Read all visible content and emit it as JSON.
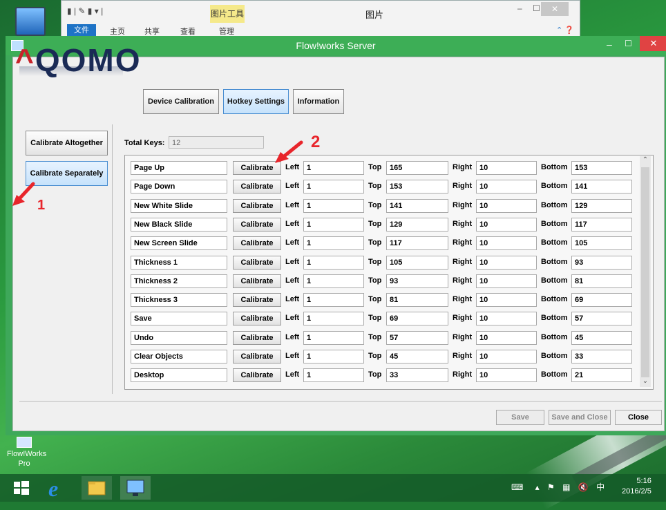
{
  "explorer": {
    "title": "图片",
    "context_tab": "图片工具",
    "tabs": [
      "文件",
      "主页",
      "共享",
      "查看",
      "管理"
    ],
    "min": "–",
    "max": "☐",
    "close": "✕"
  },
  "window": {
    "title": "Flow!works Server",
    "min": "–",
    "max": "☐",
    "close": "✕"
  },
  "logo": {
    "text": "QOMO"
  },
  "tabs": {
    "device": "Device Calibration",
    "hotkey": "Hotkey Settings",
    "info": "Information"
  },
  "side": {
    "altogether": "Calibrate Altogether",
    "separately": "Calibrate Separately"
  },
  "total_keys": {
    "label": "Total Keys:",
    "value": "12"
  },
  "field_labels": {
    "left": "Left",
    "top": "Top",
    "right": "Right",
    "bottom": "Bottom"
  },
  "calibrate_label": "Calibrate",
  "hotkeys": [
    {
      "name": "Page Up",
      "left": "1",
      "top": "165",
      "right": "10",
      "bottom": "153"
    },
    {
      "name": "Page Down",
      "left": "1",
      "top": "153",
      "right": "10",
      "bottom": "141"
    },
    {
      "name": "New White Slide",
      "left": "1",
      "top": "141",
      "right": "10",
      "bottom": "129"
    },
    {
      "name": "New Black Slide",
      "left": "1",
      "top": "129",
      "right": "10",
      "bottom": "117"
    },
    {
      "name": "New Screen Slide",
      "left": "1",
      "top": "117",
      "right": "10",
      "bottom": "105"
    },
    {
      "name": "Thickness 1",
      "left": "1",
      "top": "105",
      "right": "10",
      "bottom": "93"
    },
    {
      "name": "Thickness 2",
      "left": "1",
      "top": "93",
      "right": "10",
      "bottom": "81"
    },
    {
      "name": "Thickness 3",
      "left": "1",
      "top": "81",
      "right": "10",
      "bottom": "69"
    },
    {
      "name": "Save",
      "left": "1",
      "top": "69",
      "right": "10",
      "bottom": "57"
    },
    {
      "name": "Undo",
      "left": "1",
      "top": "57",
      "right": "10",
      "bottom": "45"
    },
    {
      "name": "Clear Objects",
      "left": "1",
      "top": "45",
      "right": "10",
      "bottom": "33"
    },
    {
      "name": "Desktop",
      "left": "1",
      "top": "33",
      "right": "10",
      "bottom": "21"
    }
  ],
  "scrollbar": {
    "up": "⌃",
    "down": "⌄"
  },
  "buttons": {
    "save": "Save",
    "save_close": "Save and Close",
    "close": "Close"
  },
  "annotations": {
    "one": "1",
    "two": "2",
    "color": "#e8252b"
  },
  "desktop_icon": {
    "label": "Flow!Works Pro"
  },
  "taskbar": {
    "icons": [
      "windows-start-icon",
      "internet-explorer-icon",
      "file-explorer-icon",
      "flowworks-server-icon"
    ],
    "tray_ime": "中",
    "time": "5:16",
    "date": "2016/2/5"
  }
}
